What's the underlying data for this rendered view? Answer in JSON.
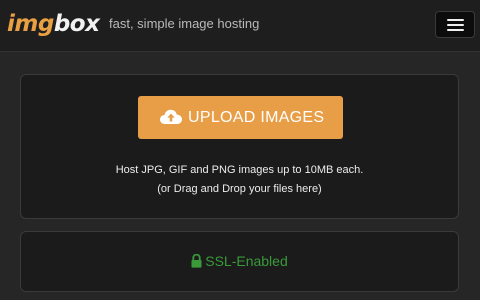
{
  "header": {
    "logo_img": "img",
    "logo_box": "box",
    "tagline": "fast, simple image hosting",
    "menu_icon": "hamburger-menu-icon"
  },
  "upload": {
    "button_label": "UPLOAD IMAGES",
    "button_icon": "cloud-upload-icon",
    "info_line1": "Host JPG, GIF and PNG images up to 10MB each.",
    "info_line2": "(or Drag and Drop your files here)"
  },
  "ssl": {
    "label": "SSL-Enabled",
    "icon": "lock-icon"
  },
  "colors": {
    "accent": "#e89e47",
    "ssl_green": "#3a9a3a",
    "background": "#262626"
  }
}
